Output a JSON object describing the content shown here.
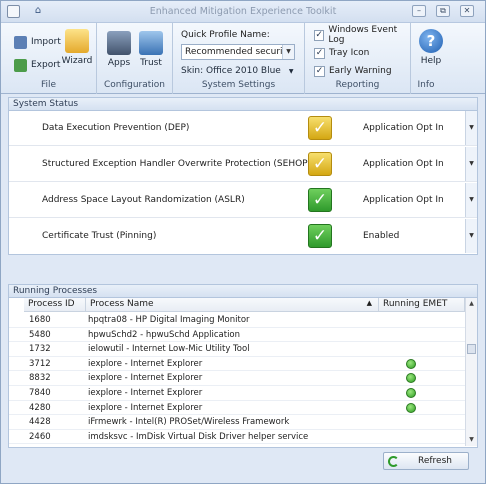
{
  "window": {
    "title": "Enhanced Mitigation Experience Toolkit",
    "min_glyph": "–",
    "restore_glyph": "⧉",
    "close_glyph": "✕",
    "qat_glyph": "⌂"
  },
  "ribbon": {
    "file": {
      "label": "File",
      "import_label": "Import",
      "export_label": "Export",
      "wizard_label": "Wizard"
    },
    "configuration": {
      "label": "Configuration",
      "apps_label": "Apps",
      "trust_label": "Trust"
    },
    "system_settings": {
      "label": "System Settings",
      "quick_profile_label": "Quick Profile Name:",
      "quick_profile_value": "Recommended security ...",
      "skin_label": "Skin: Office 2010 Blue",
      "dropdown_glyph": "▼"
    },
    "reporting": {
      "label": "Reporting",
      "event_log_label": "Windows Event Log",
      "tray_icon_label": "Tray Icon",
      "early_warning_label": "Early Warning",
      "check_glyph": "✓"
    },
    "info": {
      "label": "Info",
      "help_label": "Help",
      "help_glyph": "?"
    }
  },
  "system_status": {
    "header": "System Status",
    "rows": [
      {
        "label": "Data Execution Prevention (DEP)",
        "value": "Application Opt In",
        "state": "yellow",
        "glyph": "✓"
      },
      {
        "label": "Structured Exception Handler Overwrite Protection (SEHOP)",
        "value": "Application Opt In",
        "state": "yellow",
        "glyph": "✓"
      },
      {
        "label": "Address Space Layout Randomization (ASLR)",
        "value": "Application Opt In",
        "state": "green",
        "glyph": "✓"
      },
      {
        "label": "Certificate Trust (Pinning)",
        "value": "Enabled",
        "state": "green",
        "glyph": "✓"
      }
    ]
  },
  "running_processes": {
    "header": "Running Processes",
    "columns": [
      "Process ID",
      "Process Name",
      "Running EMET"
    ],
    "sort_glyph": "▲",
    "rows": [
      {
        "pid": "1680",
        "name": "hpqtra08 - HP Digital Imaging Monitor",
        "emet": false
      },
      {
        "pid": "5480",
        "name": "hpwuSchd2 - hpwuSchd Application",
        "emet": false
      },
      {
        "pid": "1732",
        "name": "ielowutil - Internet Low-Mic Utility Tool",
        "emet": false
      },
      {
        "pid": "3712",
        "name": "iexplore - Internet Explorer",
        "emet": true
      },
      {
        "pid": "8832",
        "name": "iexplore - Internet Explorer",
        "emet": true
      },
      {
        "pid": "7840",
        "name": "iexplore - Internet Explorer",
        "emet": true
      },
      {
        "pid": "4280",
        "name": "iexplore - Internet Explorer",
        "emet": true
      },
      {
        "pid": "4428",
        "name": "iFrmewrk - Intel(R) PROSet/Wireless Framework",
        "emet": false
      },
      {
        "pid": "2460",
        "name": "imdsksvc - ImDisk Virtual Disk Driver helper service",
        "emet": false
      }
    ],
    "refresh_label": "Refresh"
  },
  "colors": {
    "accent": "#dfe8f5",
    "green": "#2f9a2c",
    "yellow": "#d4a713"
  }
}
